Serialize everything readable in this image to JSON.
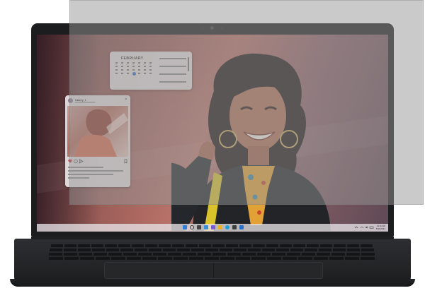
{
  "calendar": {
    "month": "FEBRUARY"
  },
  "instagram": {
    "handle": "Casey_t"
  },
  "taskbar": {
    "time": "11:11 AM",
    "date": "5/11/2021"
  },
  "colors": {
    "privacy_filter": "#969696",
    "laptop_body": "#1c1d1f",
    "wallpaper_accent": "#b87066",
    "taskbar": "#e6e1e6",
    "calendar_selected": "#2a6fc9",
    "scarf": "#e2a134",
    "jacket": "#222428",
    "strap": "#d9c22a"
  },
  "icons": {
    "start": "windows-start-icon",
    "search": "search-icon",
    "apps": [
      "task-view-icon",
      "widgets-icon",
      "chat-icon",
      "file-explorer-icon",
      "edge-icon",
      "store-icon",
      "mail-icon"
    ],
    "tray": [
      "wifi-icon",
      "volume-icon",
      "battery-icon"
    ]
  }
}
